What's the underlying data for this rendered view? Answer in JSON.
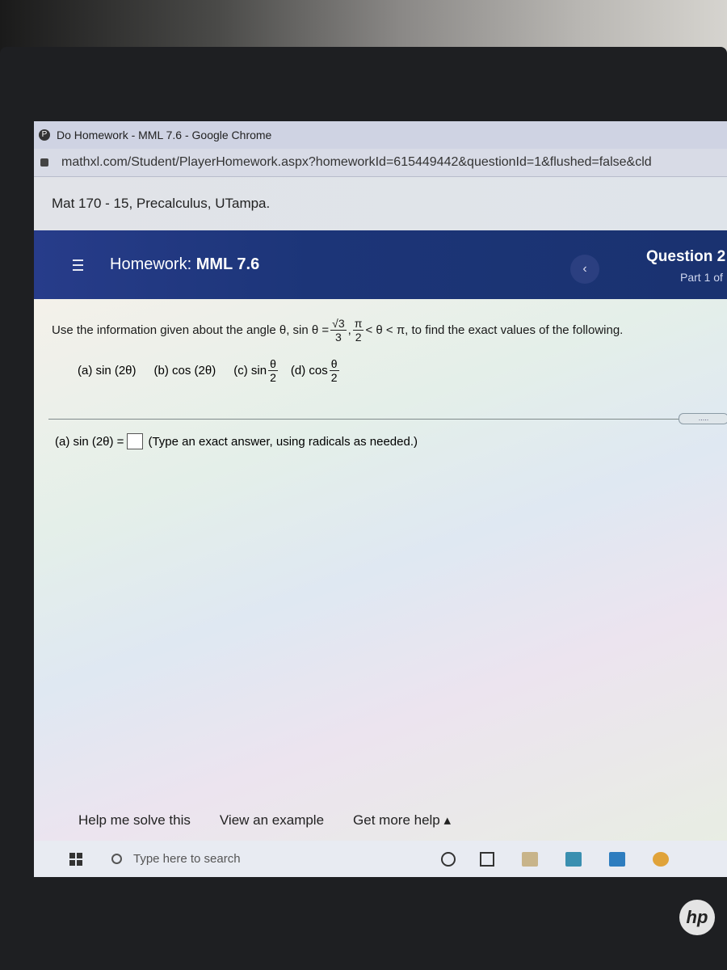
{
  "browser": {
    "window_title": "Do Homework - MML 7.6 - Google Chrome",
    "favicon_letter": "P",
    "url": "mathxl.com/Student/PlayerHomework.aspx?homeworkId=615449442&questionId=1&flushed=false&cld"
  },
  "course": {
    "title": "Mat 170 - 15, Precalculus, UTampa."
  },
  "homework": {
    "label": "Homework:",
    "name": "MML 7.6",
    "question": "Question 2",
    "part": "Part 1 of"
  },
  "problem": {
    "intro": "Use the information given about the angle θ, sin θ =",
    "sin_num": "√3",
    "sin_den": "3",
    "sep": ",",
    "pi_num": "π",
    "pi_den": "2",
    "range_end": "< θ < π, to find the exact values of the following.",
    "part_a": "(a) sin (2θ)",
    "part_b": "(b) cos (2θ)",
    "part_c": "(c) sin",
    "part_d": "(d) cos",
    "half_num": "θ",
    "half_den": "2",
    "more_label": "....."
  },
  "answer": {
    "label": "(a) sin (2θ) =",
    "value": "",
    "hint": "(Type an exact answer, using radicals as needed.)"
  },
  "help": {
    "help_solve": "Help me solve this",
    "view_example": "View an example",
    "more_help": "Get more help ▴"
  },
  "taskbar": {
    "search_placeholder": "Type here to search"
  },
  "laptop": {
    "logo": "hp"
  },
  "colors": {
    "header": "#1c3578",
    "bezel": "#1e1f22"
  }
}
